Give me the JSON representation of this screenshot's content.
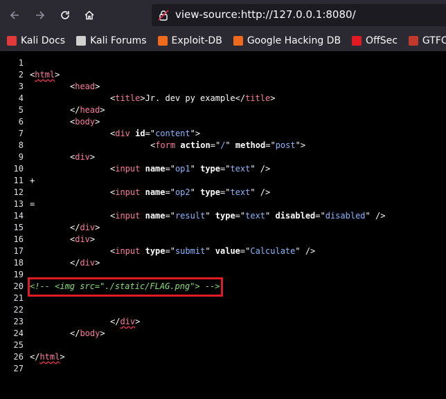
{
  "browser": {
    "url": "view-source:http://127.0.0.1:8080/",
    "bookmarks": [
      {
        "label": "Kali Docs",
        "icon": "kali-docs-icon",
        "color": "#e03a3a"
      },
      {
        "label": "Kali Forums",
        "icon": "kali-forums-icon",
        "color": "#d0d0d0"
      },
      {
        "label": "Exploit-DB",
        "icon": "exploit-db-icon",
        "color": "#f06a1e"
      },
      {
        "label": "Google Hacking DB",
        "icon": "ghdb-icon",
        "color": "#f06a1e"
      },
      {
        "label": "OffSec",
        "icon": "offsec-icon",
        "color": "#e01b24"
      },
      {
        "label": "GTFOBins",
        "icon": "gtfobins-icon",
        "color": "#c0392b"
      }
    ]
  },
  "source": {
    "line_numbers": [
      "1",
      "2",
      "3",
      "4",
      "5",
      "6",
      "7",
      "8",
      "9",
      "10",
      "11",
      "12",
      "13",
      "14",
      "15",
      "16",
      "17",
      "18",
      "19",
      "20",
      "21",
      "22",
      "23",
      "24",
      "25",
      "26",
      "27"
    ],
    "lines": [
      [],
      [
        [
          "t",
          "<"
        ],
        [
          "tr",
          "html"
        ],
        [
          "t",
          ">"
        ]
      ],
      [
        [
          "t",
          "\t"
        ],
        [
          "t",
          "<"
        ],
        [
          "tg",
          "head"
        ],
        [
          "t",
          ">"
        ]
      ],
      [
        [
          "t",
          "\t\t"
        ],
        [
          "t",
          "<"
        ],
        [
          "tg",
          "title"
        ],
        [
          "t",
          ">Jr. dev py example</"
        ],
        [
          "tg",
          "title"
        ],
        [
          "t",
          ">"
        ]
      ],
      [
        [
          "t",
          "\t"
        ],
        [
          "t",
          "</"
        ],
        [
          "tg",
          "head"
        ],
        [
          "t",
          ">"
        ]
      ],
      [
        [
          "t",
          "\t"
        ],
        [
          "t",
          "<"
        ],
        [
          "tg",
          "body"
        ],
        [
          "t",
          ">"
        ]
      ],
      [
        [
          "t",
          "\t\t"
        ],
        [
          "t",
          "<"
        ],
        [
          "tg",
          "div"
        ],
        [
          "t",
          " "
        ],
        [
          "a",
          "id"
        ],
        [
          "t",
          "=\""
        ],
        [
          "v",
          "content"
        ],
        [
          "t",
          "\">"
        ]
      ],
      [
        [
          "t",
          "\t\t\t"
        ],
        [
          "t",
          "<"
        ],
        [
          "tg",
          "form"
        ],
        [
          "t",
          " "
        ],
        [
          "a",
          "action"
        ],
        [
          "t",
          "=\""
        ],
        [
          "v",
          "/"
        ],
        [
          "t",
          "\" "
        ],
        [
          "a",
          "method"
        ],
        [
          "t",
          "=\""
        ],
        [
          "v",
          "post"
        ],
        [
          "t",
          "\">"
        ]
      ],
      [
        [
          "t",
          "\t"
        ],
        [
          "t",
          "<"
        ],
        [
          "tg",
          "div"
        ],
        [
          "t",
          ">"
        ]
      ],
      [
        [
          "t",
          "\t\t"
        ],
        [
          "t",
          "<"
        ],
        [
          "tg",
          "input"
        ],
        [
          "t",
          " "
        ],
        [
          "a",
          "name"
        ],
        [
          "t",
          "=\""
        ],
        [
          "v",
          "op1"
        ],
        [
          "t",
          "\" "
        ],
        [
          "a",
          "type"
        ],
        [
          "t",
          "=\""
        ],
        [
          "v",
          "text"
        ],
        [
          "t",
          "\" />"
        ]
      ],
      [
        [
          "t",
          "\t\t+"
        ]
      ],
      [
        [
          "t",
          "\t\t"
        ],
        [
          "t",
          "<"
        ],
        [
          "tg",
          "input"
        ],
        [
          "t",
          " "
        ],
        [
          "a",
          "name"
        ],
        [
          "t",
          "=\""
        ],
        [
          "v",
          "op2"
        ],
        [
          "t",
          "\" "
        ],
        [
          "a",
          "type"
        ],
        [
          "t",
          "=\""
        ],
        [
          "v",
          "text"
        ],
        [
          "t",
          "\" />"
        ]
      ],
      [
        [
          "t",
          "\t\t="
        ]
      ],
      [
        [
          "t",
          "\t\t"
        ],
        [
          "t",
          "<"
        ],
        [
          "tg",
          "input"
        ],
        [
          "t",
          " "
        ],
        [
          "a",
          "name"
        ],
        [
          "t",
          "=\""
        ],
        [
          "v",
          "result"
        ],
        [
          "t",
          "\" "
        ],
        [
          "a",
          "type"
        ],
        [
          "t",
          "=\""
        ],
        [
          "v",
          "text"
        ],
        [
          "t",
          "\" "
        ],
        [
          "a",
          "disabled"
        ],
        [
          "t",
          "=\""
        ],
        [
          "v",
          "disabled"
        ],
        [
          "t",
          "\" />"
        ]
      ],
      [
        [
          "t",
          "\t"
        ],
        [
          "t",
          "</"
        ],
        [
          "tg",
          "div"
        ],
        [
          "t",
          ">"
        ]
      ],
      [
        [
          "t",
          "\t"
        ],
        [
          "t",
          "<"
        ],
        [
          "tg",
          "div"
        ],
        [
          "t",
          ">"
        ]
      ],
      [
        [
          "t",
          "\t\t"
        ],
        [
          "t",
          "<"
        ],
        [
          "tg",
          "input"
        ],
        [
          "t",
          " "
        ],
        [
          "a",
          "type"
        ],
        [
          "t",
          "=\""
        ],
        [
          "v",
          "submit"
        ],
        [
          "t",
          "\" "
        ],
        [
          "a",
          "value"
        ],
        [
          "t",
          "=\""
        ],
        [
          "v",
          "Calculate"
        ],
        [
          "t",
          "\" />"
        ]
      ],
      [
        [
          "t",
          "\t"
        ],
        [
          "t",
          "</"
        ],
        [
          "tg",
          "div"
        ],
        [
          "t",
          ">"
        ]
      ],
      [],
      [
        [
          "c",
          "<!-- <img src=\"./static/FLAG.png\"> -->"
        ]
      ],
      [],
      [],
      [
        [
          "t",
          "\t\t"
        ],
        [
          "t",
          "</"
        ],
        [
          "tr",
          "div"
        ],
        [
          "t",
          ">"
        ]
      ],
      [
        [
          "t",
          "\t"
        ],
        [
          "t",
          "</"
        ],
        [
          "tg",
          "body"
        ],
        [
          "t",
          ">"
        ]
      ],
      [],
      [
        [
          "t",
          "</"
        ],
        [
          "tr",
          "html"
        ],
        [
          "t",
          ">"
        ]
      ],
      []
    ]
  },
  "colors": {
    "highlight_box": "#e01b24",
    "tag": "#ff7aa0",
    "attr_value": "#8ab8ff",
    "comment": "#86de74"
  }
}
